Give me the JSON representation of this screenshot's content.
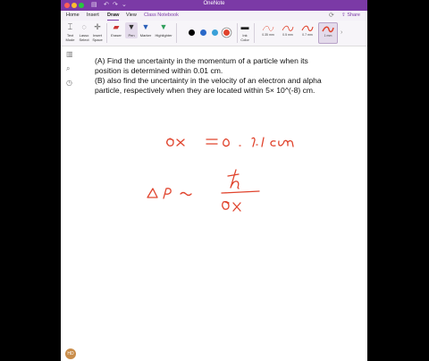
{
  "window": {
    "title": "OneNote"
  },
  "tabs": [
    {
      "label": "Home"
    },
    {
      "label": "Insert"
    },
    {
      "label": "Draw"
    },
    {
      "label": "View"
    },
    {
      "label": "Class Notebook"
    }
  ],
  "share_label": "Share",
  "ribbon": {
    "text_mode": "Text Mode",
    "lasso": "Lasso Select",
    "insert_space": "Insert Space",
    "eraser": "Eraser",
    "pen": "Pen",
    "marker": "Marker",
    "highlighter": "Highlighter",
    "colors": [
      "#000000",
      "#2a68c8",
      "#3aa0d8",
      "#e0432c"
    ],
    "ink_color": "Ink Color",
    "widths": [
      "0.35 mm",
      "0.5 mm",
      "0.7 mm",
      "1 mm"
    ],
    "selected_width": "1 mm",
    "ink_accent": "#e0432c"
  },
  "note": {
    "p1": "(A) Find the uncertainty in the momentum of a particle when its position is determined within 0.01 cm.",
    "p2": "(B) also find the uncertainty in the velocity of an electron and alpha particle, respectively when they are located within 5× 10^(-8) cm."
  },
  "user_initials": "HD"
}
